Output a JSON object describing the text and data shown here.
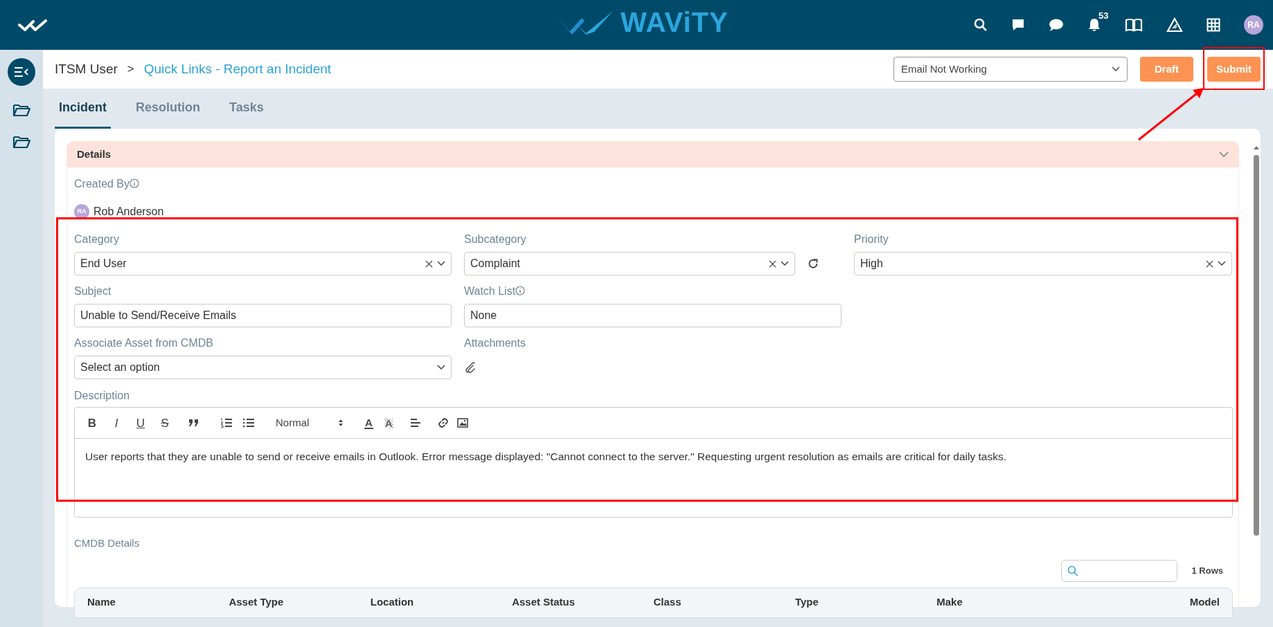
{
  "top_bar": {
    "brand": "WAViTY",
    "notification_count": "53",
    "avatar": "RA"
  },
  "header": {
    "breadcrumb_root": "ITSM User",
    "separator": ">",
    "breadcrumb_current": "Quick Links - Report an Incident",
    "template_select": "Email Not Working",
    "buttons": [
      "Draft",
      "Submit"
    ]
  },
  "tabs": [
    {
      "label": "Incident",
      "selected": true
    },
    {
      "label": "Resolution",
      "selected": false
    },
    {
      "label": "Tasks",
      "selected": false
    }
  ],
  "details": {
    "title": "Details",
    "created_by_label": "Created By",
    "creator_initials": "RA",
    "creator_name": "Rob Anderson",
    "fields": [
      {
        "kind": "select",
        "label": "Category",
        "value": "End User",
        "clearable": true
      },
      {
        "kind": "select",
        "label": "Subcategory",
        "value": "Complaint",
        "clearable": true,
        "refresh": true
      },
      {
        "kind": "select",
        "label": "Priority",
        "value": "High",
        "clearable": true
      },
      {
        "kind": "text",
        "label": "Subject",
        "value": "Unable to Send/Receive Emails"
      },
      {
        "kind": "text",
        "label": "Watch List",
        "value": "None",
        "info": true
      },
      {
        "kind": "blank"
      },
      {
        "kind": "select",
        "label": "Associate Asset from CMDB",
        "value": "Select an option",
        "clearable": false
      },
      {
        "kind": "attachment",
        "label": "Attachments"
      }
    ],
    "description": {
      "label": "Description",
      "format_buttons": [
        "B",
        "I",
        "U",
        "S"
      ],
      "heading_select": "Normal",
      "color_buttons": [
        "A",
        "A"
      ],
      "text": "User reports that they are unable to send or receive emails in Outlook. Error message displayed: \"Cannot connect to the server.\" Requesting urgent resolution as emails are critical for daily tasks."
    }
  },
  "cmdb": {
    "title": "CMDB Details",
    "row_count": "1 Rows",
    "columns": [
      "Name",
      "Asset Type",
      "Location",
      "Asset Status",
      "Class",
      "Type",
      "Make",
      "Model"
    ]
  }
}
